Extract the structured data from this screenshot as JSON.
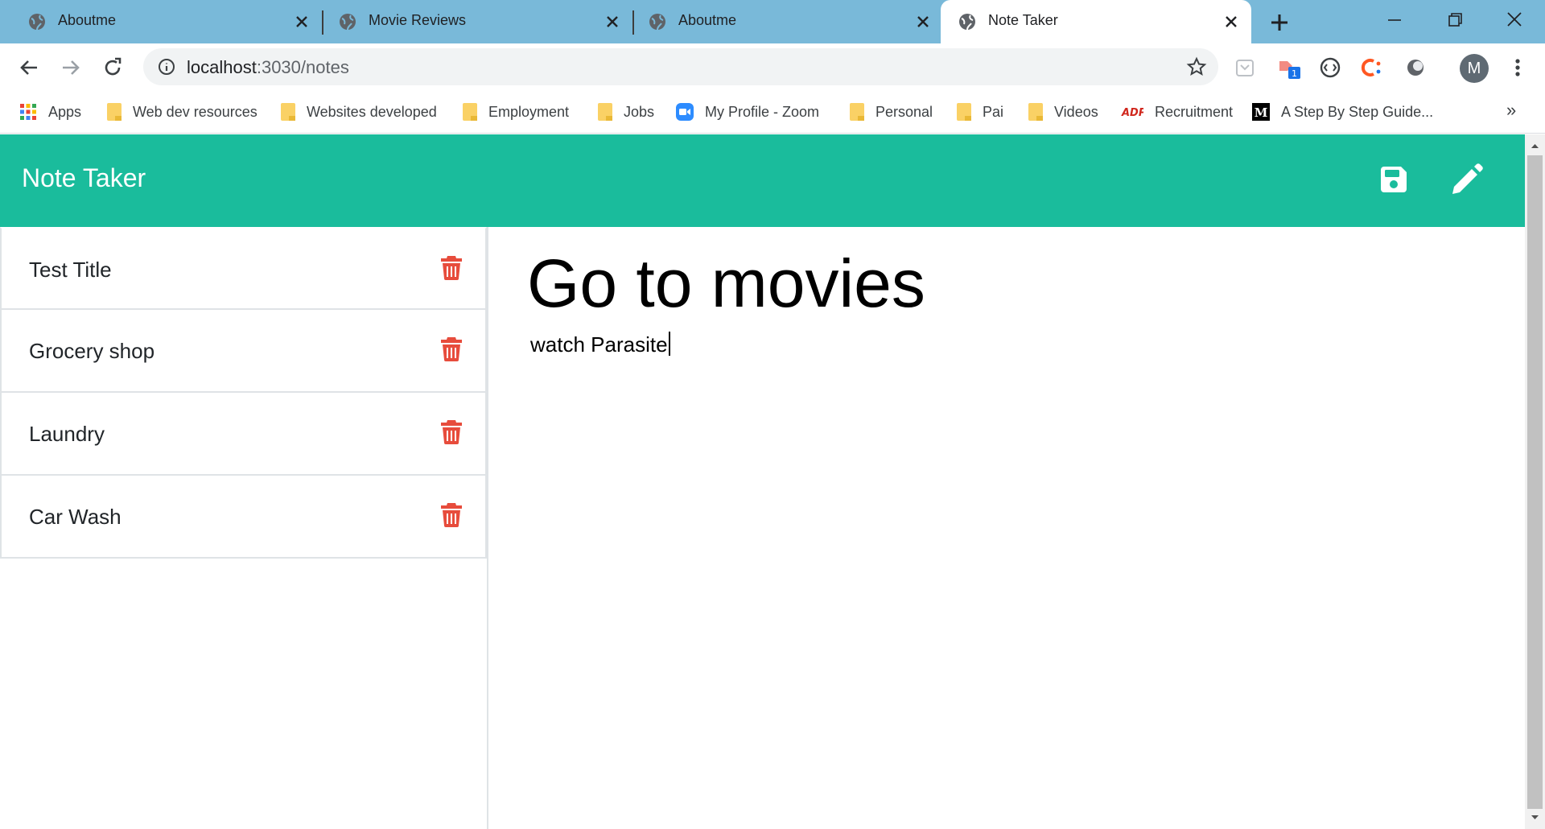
{
  "browser": {
    "tabs": [
      {
        "title": "Aboutme",
        "active": false
      },
      {
        "title": "Movie Reviews",
        "active": false
      },
      {
        "title": "Aboutme",
        "active": false
      },
      {
        "title": "Note Taker",
        "active": true
      }
    ],
    "address": {
      "host": "localhost",
      "path": ":3030/notes"
    },
    "profile_initial": "M",
    "bookmarks": [
      {
        "label": "Apps",
        "icon": "apps-grid-icon"
      },
      {
        "label": "Web dev resources",
        "icon": "folder-icon"
      },
      {
        "label": "Websites developed",
        "icon": "folder-icon"
      },
      {
        "label": "Employment",
        "icon": "folder-icon"
      },
      {
        "label": "Jobs",
        "icon": "folder-icon"
      },
      {
        "label": "My Profile - Zoom",
        "icon": "zoom-icon"
      },
      {
        "label": "Personal",
        "icon": "folder-icon"
      },
      {
        "label": "Pai",
        "icon": "folder-icon"
      },
      {
        "label": "Videos",
        "icon": "folder-icon"
      },
      {
        "label": "Recruitment",
        "icon": "adp-icon"
      },
      {
        "label": "A Step By Step Guide...",
        "icon": "medium-icon"
      }
    ],
    "bookmarks_overflow": "»"
  },
  "app": {
    "brand": "Note Taker",
    "accent_color": "#1abc9c",
    "delete_color": "#e74c3c",
    "notes": [
      {
        "title": "Test Title"
      },
      {
        "title": "Grocery shop"
      },
      {
        "title": "Laundry"
      },
      {
        "title": "Car Wash"
      }
    ],
    "editor": {
      "title": "Go to movies",
      "text": "watch Parasite"
    }
  }
}
